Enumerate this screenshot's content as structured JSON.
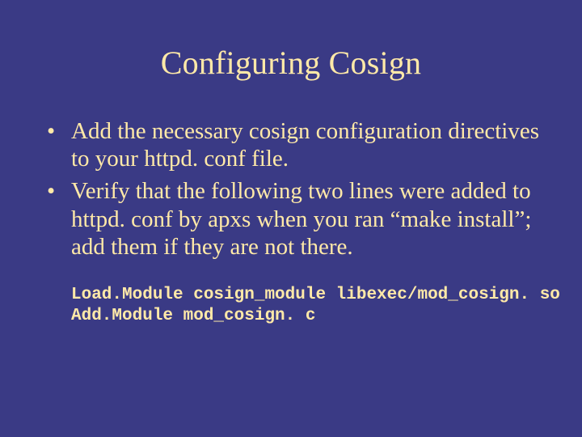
{
  "slide": {
    "title": "Configuring Cosign",
    "bullets": [
      "Add the necessary cosign configuration directives to your httpd. conf file.",
      "Verify that the following two lines were added to httpd. conf by apxs when you ran “make install”; add them if they are not there."
    ],
    "code_lines": [
      "Load.Module cosign_module libexec/mod_cosign. so",
      "Add.Module mod_cosign. c"
    ]
  }
}
